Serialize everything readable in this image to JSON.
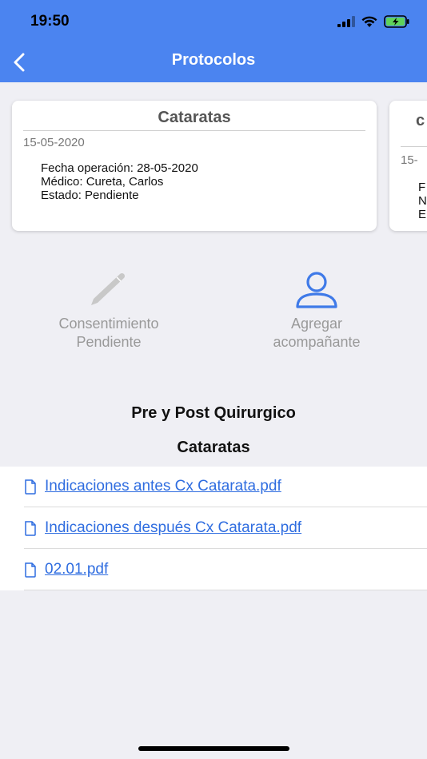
{
  "status_bar": {
    "time": "19:50"
  },
  "header": {
    "title": "Protocolos"
  },
  "cards": [
    {
      "title": "Cataratas",
      "date": "15-05-2020",
      "lines": [
        "Fecha operación: 28-05-2020",
        "Médico: Cureta, Carlos",
        "Estado: Pendiente"
      ]
    },
    {
      "title_partial": "c",
      "date_partial": "15-",
      "lines_partial": [
        "F",
        "N",
        "E"
      ]
    }
  ],
  "actions": {
    "consent": {
      "line1": "Consentimiento",
      "line2": "Pendiente"
    },
    "companion": {
      "line1": "Agregar",
      "line2": "acompañante"
    }
  },
  "section": {
    "title": "Pre y Post Quirurgico",
    "subtitle": "Cataratas"
  },
  "files": [
    {
      "label": " Indicaciones antes Cx Catarata.pdf"
    },
    {
      "label": " Indicaciones después Cx Catarata.pdf"
    },
    {
      "label": " 02.01.pdf"
    }
  ],
  "colors": {
    "header": "#4b84f0",
    "link": "#2f6de0",
    "icon_active": "#3f7ae8",
    "icon_disabled": "#c8c8c8"
  }
}
